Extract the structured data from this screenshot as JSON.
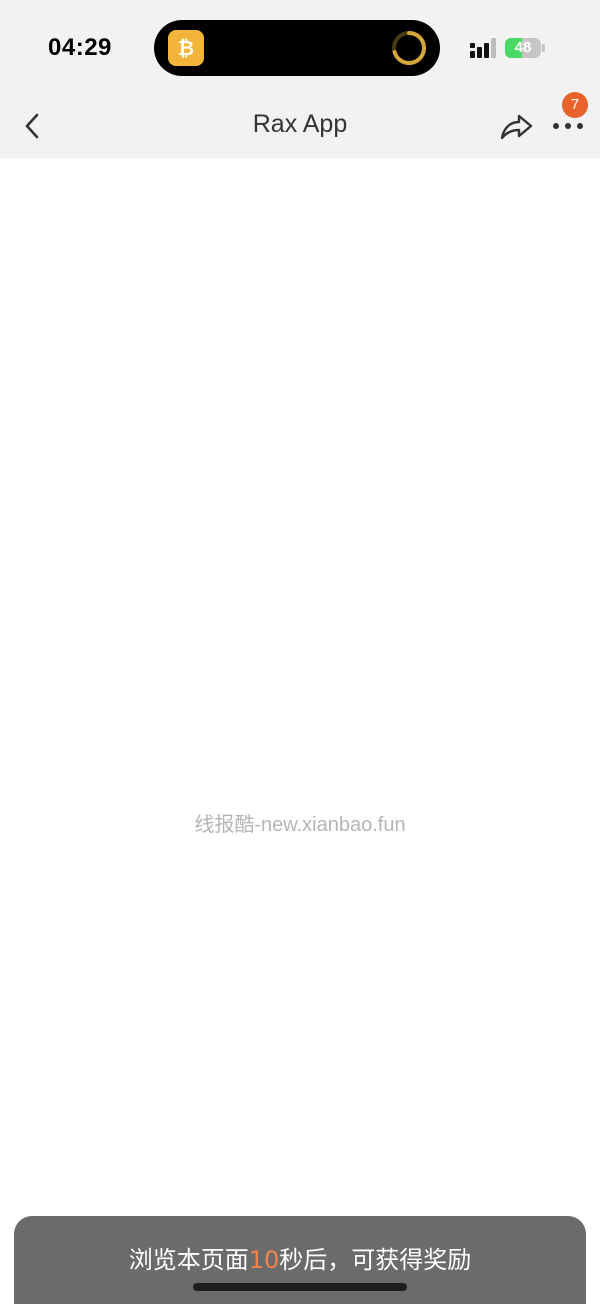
{
  "status_bar": {
    "time": "04:29",
    "battery_level": "48",
    "battery_fraction": 0.48,
    "signal_icon": "cellular-signal-icon",
    "charging_icon": "charging-bolt-icon"
  },
  "dynamic_island": {
    "left_icon": "bitcoin-icon",
    "right_icon": "progress-ring-icon"
  },
  "nav": {
    "title": "Rax App",
    "back_icon": "chevron-left-icon",
    "share_icon": "share-icon",
    "more_icon": "more-dots-icon",
    "badge_count": "7"
  },
  "content": {
    "watermark": "线报酷-new.xianbao.fun"
  },
  "toast": {
    "prefix": "浏览本页面",
    "count": "10",
    "suffix": "秒后，可获得奖励"
  },
  "colors": {
    "accent": "#e8622a",
    "toast_bg": "#6b6b6b",
    "battery_green": "#4cd964",
    "bitcoin_yellow": "#f2b43b"
  }
}
